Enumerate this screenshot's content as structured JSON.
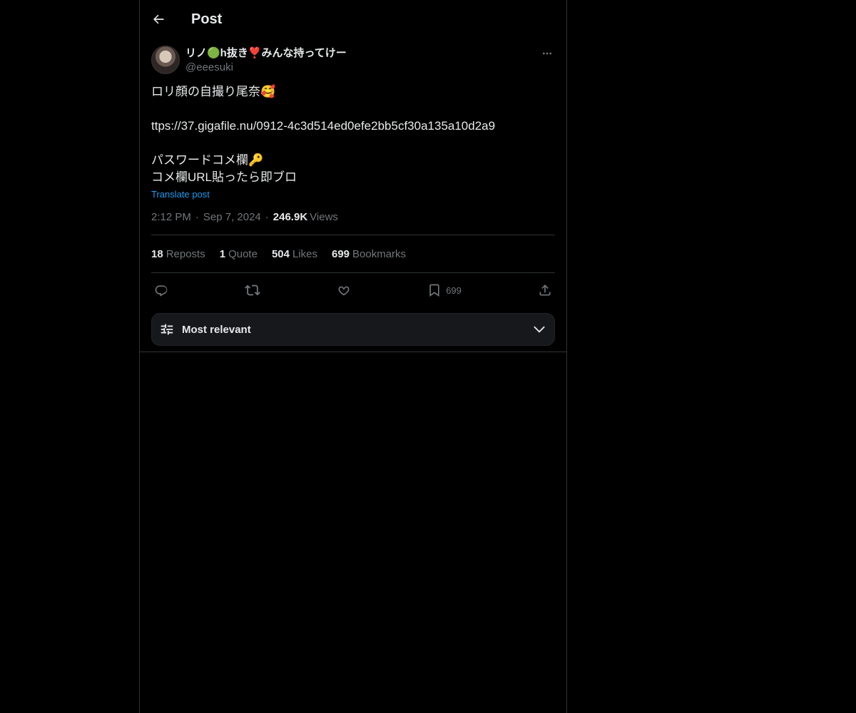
{
  "header": {
    "title": "Post",
    "back_icon": "arrow-left-icon"
  },
  "author": {
    "display_name": "リノ🟢h抜き❣️みんな持ってけー",
    "handle": "@eeesuki"
  },
  "post": {
    "lines": [
      "ロリ顔の自撮り尾奈🥰",
      "",
      "ttps://37.gigafile.nu/0912-4c3d514ed0efe2bb5cf30a135a10d2a9",
      "",
      "パスワードコメ欄🔑",
      "コメ欄URL貼ったら即ブロ"
    ],
    "translate_label": "Translate post"
  },
  "meta": {
    "time": "2:12 PM",
    "date": "Sep 7, 2024",
    "views_count": "246.9K",
    "views_label": "Views"
  },
  "stats": {
    "reposts_count": "18",
    "reposts_label": "Reposts",
    "quote_count": "1",
    "quote_label": "Quote",
    "likes_count": "504",
    "likes_label": "Likes",
    "bookmarks_count": "699",
    "bookmarks_label": "Bookmarks"
  },
  "actions": {
    "bookmark_count": "699"
  },
  "sort": {
    "label": "Most relevant"
  },
  "colors": {
    "accent": "#1d9bf0",
    "background": "#000000",
    "border": "#2f3336",
    "muted": "#71767b",
    "text": "#e7e9ea"
  }
}
